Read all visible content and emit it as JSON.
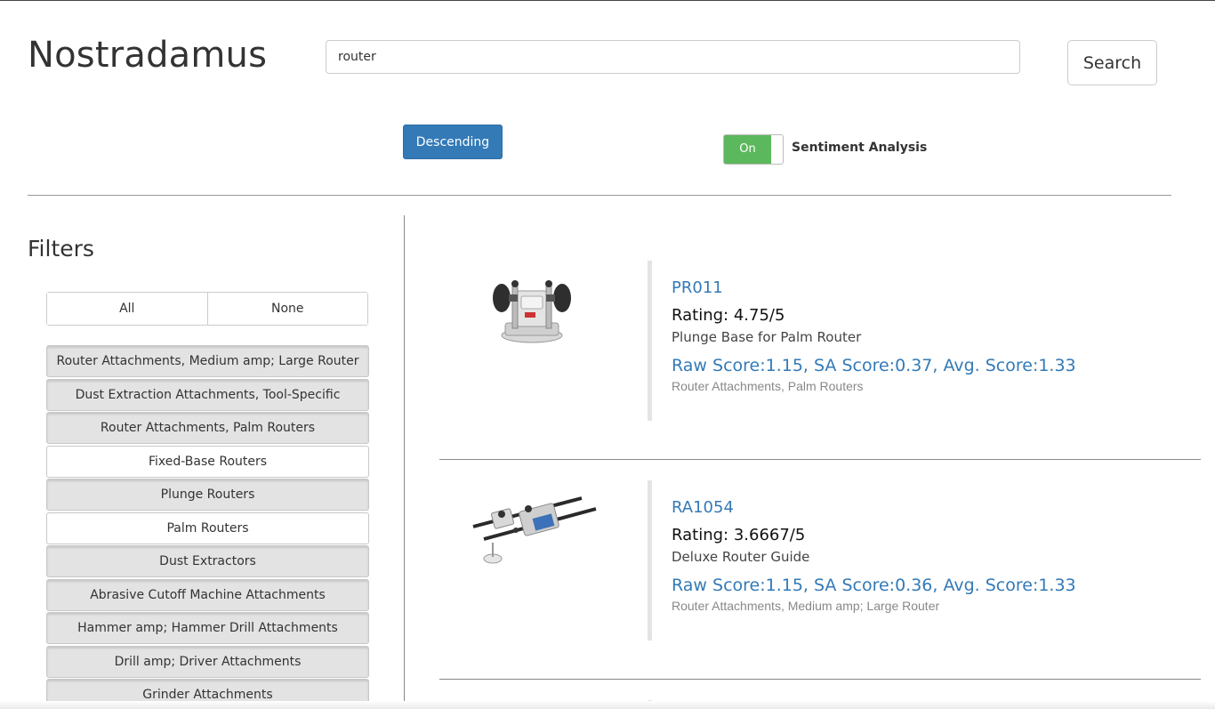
{
  "app": {
    "title": "Nostradamus"
  },
  "search": {
    "value": "router",
    "button_label": "Search"
  },
  "controls": {
    "sort_label": "Descending",
    "sentiment_toggle": {
      "state_label": "On",
      "label": "Sentiment Analysis",
      "color": "#5cb85c"
    }
  },
  "filters": {
    "title": "Filters",
    "all_label": "All",
    "none_label": "None",
    "items": [
      {
        "label": "Router Attachments, Medium amp; Large Router",
        "selected": true
      },
      {
        "label": "Dust Extraction Attachments, Tool-Specific",
        "selected": true
      },
      {
        "label": "Router Attachments, Palm Routers",
        "selected": true
      },
      {
        "label": "Fixed-Base Routers",
        "selected": false
      },
      {
        "label": "Plunge Routers",
        "selected": true
      },
      {
        "label": "Palm Routers",
        "selected": false
      },
      {
        "label": "Dust Extractors",
        "selected": true
      },
      {
        "label": "Abrasive Cutoff Machine Attachments",
        "selected": true
      },
      {
        "label": "Hammer amp; Hammer Drill Attachments",
        "selected": true
      },
      {
        "label": "Drill amp; Driver Attachments",
        "selected": true
      },
      {
        "label": "Grinder Attachments",
        "selected": true
      }
    ]
  },
  "results": [
    {
      "model": "PR011",
      "rating": "Rating: 4.75/5",
      "description": "Plunge Base for Palm Router",
      "scores": "Raw Score:1.15, SA Score:0.37, Avg. Score:1.33",
      "categories": "Router Attachments, Palm Routers",
      "image_icon": "plunge-base-product-image"
    },
    {
      "model": "RA1054",
      "rating": "Rating: 3.6667/5",
      "description": "Deluxe Router Guide",
      "scores": "Raw Score:1.15, SA Score:0.36, Avg. Score:1.33",
      "categories": "Router Attachments, Medium amp; Large Router",
      "image_icon": "router-guide-product-image"
    }
  ],
  "colors": {
    "link": "#337ab7",
    "primary_button": "#337ab7",
    "toggle_on": "#5cb85c"
  }
}
